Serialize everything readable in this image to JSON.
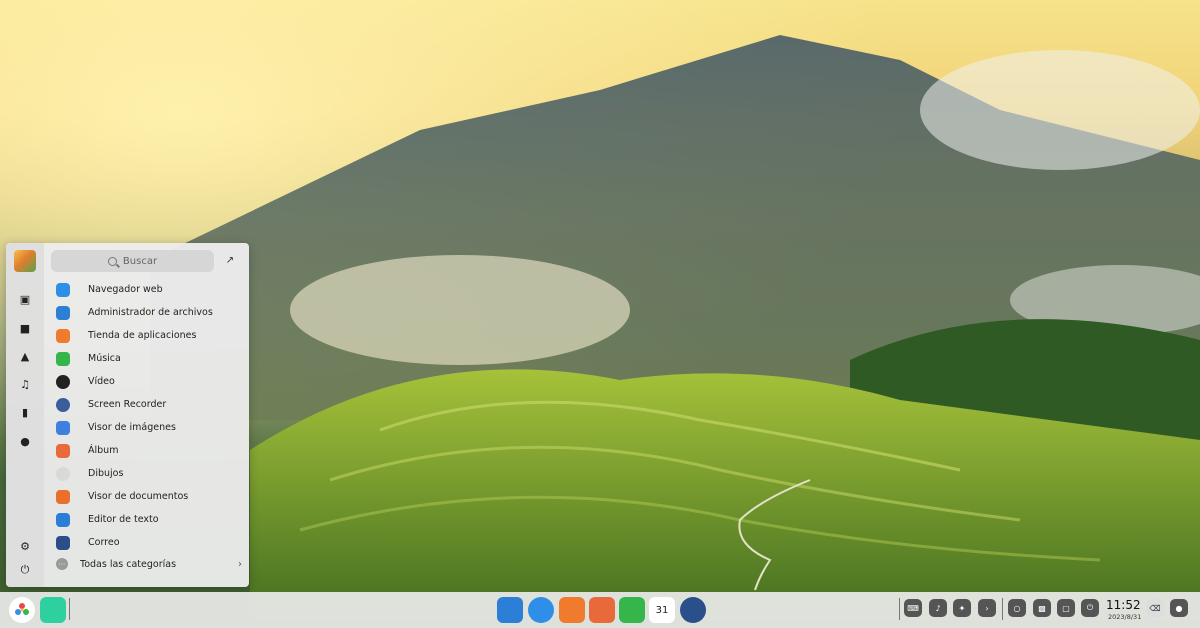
{
  "launcher": {
    "search_placeholder": "Buscar",
    "apps": [
      {
        "label": "Navegador web",
        "icon": "browser-icon",
        "color": "#2f8ee8"
      },
      {
        "label": "Administrador de archivos",
        "icon": "file-manager-icon",
        "color": "#2b7fd6"
      },
      {
        "label": "Tienda de aplicaciones",
        "icon": "app-store-icon",
        "color": "#f07a2d"
      },
      {
        "label": "Música",
        "icon": "music-icon",
        "color": "#35b54a"
      },
      {
        "label": "Vídeo",
        "icon": "video-icon",
        "color": "#222222"
      },
      {
        "label": "Screen Recorder",
        "icon": "screen-recorder-icon",
        "color": "#3a5d9c"
      },
      {
        "label": "Visor de imágenes",
        "icon": "image-viewer-icon",
        "color": "#3f7fe0"
      },
      {
        "label": "Álbum",
        "icon": "album-icon",
        "color": "#e86a3a"
      },
      {
        "label": "Dibujos",
        "icon": "draw-icon",
        "color": "#d9d9d9"
      },
      {
        "label": "Visor de documentos",
        "icon": "document-viewer-icon",
        "color": "#e8702a"
      },
      {
        "label": "Editor de texto",
        "icon": "text-editor-icon",
        "color": "#2a7ed8"
      },
      {
        "label": "Correo",
        "icon": "mail-icon",
        "color": "#2b4e8a"
      }
    ],
    "all_categories": "Todas las categorías"
  },
  "dock": {
    "clock_time": "11:52",
    "clock_date": "2023/8/31",
    "calendar_day": "31"
  }
}
